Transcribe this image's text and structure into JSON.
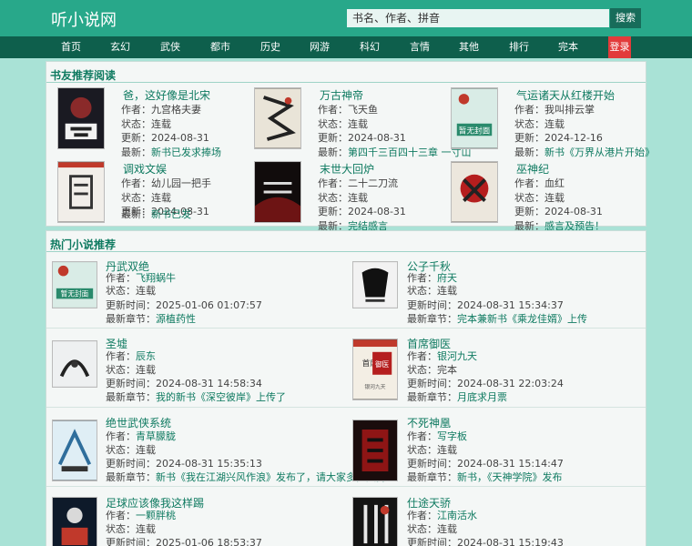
{
  "site": {
    "logo": "听小说网"
  },
  "search": {
    "placeholder": "书名、作者、拼音",
    "button": "搜索"
  },
  "nav": {
    "items": [
      "首页",
      "玄幻",
      "武侠",
      "都市",
      "历史",
      "网游",
      "科幻",
      "言情",
      "其他",
      "排行",
      "完本"
    ],
    "login": "登录"
  },
  "recommend": {
    "title": "书友推荐阅读",
    "books": [
      {
        "title": "爸，这好像是北宋",
        "author": "作者：九宫格夫妻",
        "status": "状态：连载",
        "updated": "更新：2024-08-31",
        "latest_label": "最新：",
        "latest": "新书已发求捧场"
      },
      {
        "title": "万古神帝",
        "author": "作者：飞天鱼",
        "status": "状态：连载",
        "updated": "更新：2024-08-31",
        "latest_label": "最新：",
        "latest": "第四千三百四十三章 一寸山"
      },
      {
        "title": "气运诸天从红楼开始",
        "author": "作者：我叫排云掌",
        "status": "状态：连载",
        "updated": "更新：2024-12-16",
        "latest_label": "最新：",
        "latest": "新书《万界从港片开始》"
      },
      {
        "title": "调戏文娱",
        "author": "作者：幼儿园一把手",
        "status": "状态：连载",
        "updated": "更新：2024-08-31",
        "latest_label": "最新：",
        "latest": "新书已发"
      },
      {
        "title": "末世大回炉",
        "author": "作者：二十二刀流",
        "status": "状态：连载",
        "updated": "更新：2024-08-31",
        "latest_label": "最新：",
        "latest": "完结感言"
      },
      {
        "title": "巫神纪",
        "author": "作者：血红",
        "status": "状态：连载",
        "updated": "更新：2024-08-31",
        "latest_label": "最新：",
        "latest": "感言及预告！"
      }
    ]
  },
  "hot": {
    "title": "热门小说推荐",
    "labels": {
      "author": "作者：",
      "status": "状态：",
      "updated": "更新时间：",
      "latest": "最新章节："
    },
    "books": [
      {
        "title": "丹武双绝",
        "author": "飞翔蜗牛",
        "status": "连载",
        "updated": "2025-01-06 01:07:57",
        "latest": "源植药性"
      },
      {
        "title": "公子千秋",
        "author": "府天",
        "status": "连载",
        "updated": "2024-08-31 15:34:37",
        "latest": "完本兼新书《乘龙佳婿》上传"
      },
      {
        "title": "圣墟",
        "author": "辰东",
        "status": "连载",
        "updated": "2024-08-31 14:58:34",
        "latest": "我的新书《深空彼岸》上传了"
      },
      {
        "title": "首席御医",
        "author": "银河九天",
        "status": "完本",
        "updated": "2024-08-31 22:03:24",
        "latest": "月底求月票"
      },
      {
        "title": "绝世武侠系统",
        "author": "青草朦胧",
        "status": "连载",
        "updated": "2024-08-31 15:35:13",
        "latest": "新书《我在江湖兴风作浪》发布了，请大家多多支持！"
      },
      {
        "title": "不死神凰",
        "author": "写字板",
        "status": "连载",
        "updated": "2024-08-31 15:14:47",
        "latest": "新书，《天神学院》发布"
      },
      {
        "title": "足球应该像我这样踢",
        "author": "一颗胖桃",
        "status": "连载",
        "updated": "2025-01-06 18:53:37",
        "latest": ""
      },
      {
        "title": "仕途天骄",
        "author": "江南活水",
        "status": "连载",
        "updated": "2024-08-31 15:19:43",
        "latest": ""
      }
    ]
  },
  "cover_texts": {
    "placeholder": "暂无封面",
    "shouxi": "首席",
    "yuyi": "御医",
    "yuyi_author": "银河九天"
  },
  "colors": {
    "accent": "#28a88a",
    "nav": "#0e5f4c",
    "link": "#0e7a60",
    "login": "#e23b3b"
  }
}
